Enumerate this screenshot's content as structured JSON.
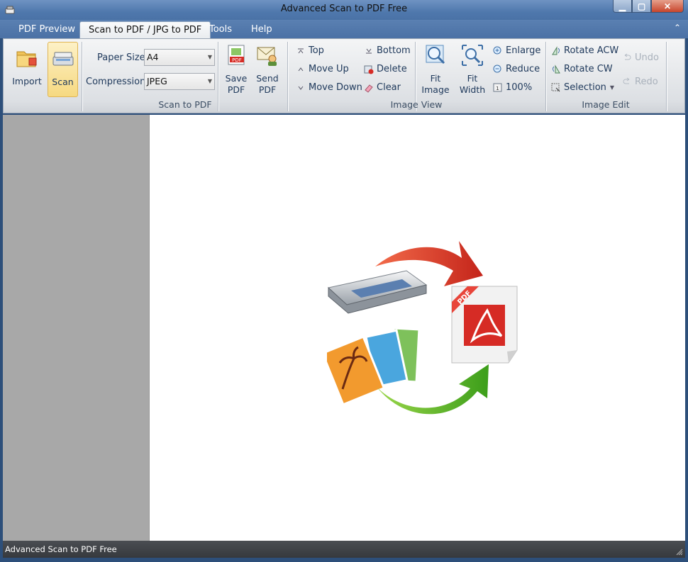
{
  "window": {
    "title": "Advanced Scan to PDF Free"
  },
  "menu": {
    "tabs": [
      "PDF Preview",
      "Scan to PDF / JPG to PDF",
      "Tools",
      "Help"
    ]
  },
  "ribbon": {
    "scan_group": {
      "label": "Scan to PDF",
      "import_label": "Import",
      "scan_label": "Scan",
      "paper_size_label": "Paper Size",
      "paper_size_value": "A4",
      "compression_label": "Compression",
      "compression_value": "JPEG",
      "save_pdf_label": [
        "Save",
        "PDF"
      ],
      "send_pdf_label": [
        "Send",
        "PDF"
      ]
    },
    "image_view_group": {
      "label": "Image View",
      "top": "Top",
      "move_up": "Move Up",
      "move_down": "Move Down",
      "bottom": "Bottom",
      "delete": "Delete",
      "clear": "Clear",
      "fit_image": [
        "Fit",
        "Image"
      ],
      "fit_width": [
        "Fit",
        "Width"
      ],
      "enlarge": "Enlarge",
      "reduce": "Reduce",
      "zoom_100": "100%"
    },
    "image_edit_group": {
      "label": "Image Edit",
      "rotate_acw": "Rotate ACW",
      "rotate_cw": "Rotate CW",
      "selection": "Selection",
      "undo": "Undo",
      "redo": "Redo"
    }
  },
  "canvas": {
    "badge_text": "PDF"
  },
  "status": {
    "text": "Advanced Scan to PDF Free"
  },
  "colors": {
    "accent_tab": "#eef1f4",
    "pressed": "#f6d981",
    "title_bar": "#4f78ad",
    "pdf_red": "#d62b25",
    "arrow_red": "#d93a22",
    "arrow_green": "#4cae1f"
  }
}
